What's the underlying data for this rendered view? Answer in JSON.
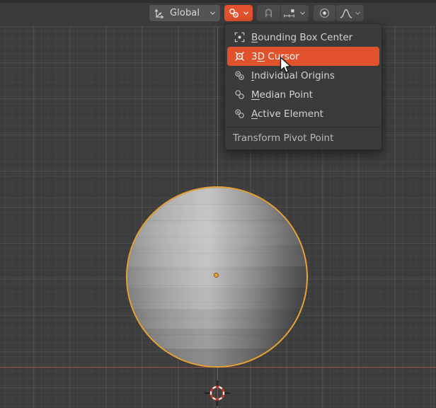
{
  "app": {
    "name": "Blender 3D Viewport",
    "accent_color": "#e0512c",
    "background_color": "#3d3d3d",
    "header_color": "#3b3b3b",
    "selection_outline_color": "#e8a135"
  },
  "header": {
    "orientation_button": {
      "label": "Global",
      "icon": "transform-orientation-icon",
      "dropdown_icon": "chevron-down-icon"
    },
    "pivot_button": {
      "label": "",
      "icon": "pivot-point-icon",
      "dropdown_icon": "chevron-down-icon",
      "active": true
    },
    "snap_magnet_button": {
      "icon": "magnet-icon",
      "label": ""
    },
    "snap_to_button": {
      "icon": "snap-increment-icon",
      "dropdown_icon": "chevron-down-icon",
      "label": ""
    },
    "proportional_edit_button": {
      "icon": "proportional-editing-icon",
      "label": ""
    },
    "falloff_button": {
      "icon": "smooth-falloff-curve-icon",
      "dropdown_icon": "chevron-down-icon",
      "label": ""
    }
  },
  "pivot_menu": {
    "title": "Transform Pivot Point",
    "items": [
      {
        "label": "Bounding Box Center",
        "accel": "B",
        "icon": "bounding-box-center-icon",
        "active": false
      },
      {
        "label": "3D Cursor",
        "accel": "D",
        "icon": "3d-cursor-icon",
        "active": true
      },
      {
        "label": "Individual Origins",
        "accel": "I",
        "icon": "individual-origins-icon",
        "active": false
      },
      {
        "label": "Median Point",
        "accel": "M",
        "icon": "median-point-icon",
        "active": false
      },
      {
        "label": "Active Element",
        "accel": "A",
        "icon": "active-element-icon",
        "active": false
      }
    ]
  },
  "viewport": {
    "object": "uv-sphere",
    "object_selected": true,
    "grid_visible": true,
    "x_axis_color": "#9b5449",
    "z_axis_color": "#4a6a92",
    "cursor_3d_visible": true,
    "object_origin_visible": true
  }
}
